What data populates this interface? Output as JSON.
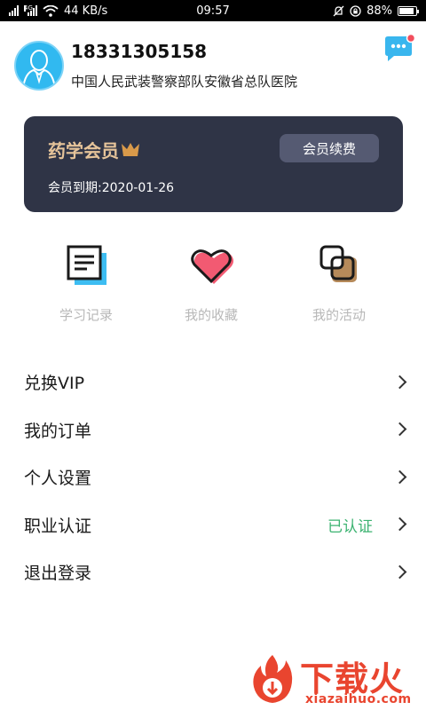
{
  "status_bar": {
    "network_speed": "44 KB/s",
    "time": "09:57",
    "battery": "88%",
    "battery_level": 0.88,
    "sig_tag": "4G"
  },
  "profile": {
    "phone": "18331305158",
    "organization": "中国人民武装警察部队安徽省总队医院"
  },
  "member_card": {
    "title": "药学会员",
    "renew_label": "会员续费",
    "expiry_text": "会员到期:2020-01-26"
  },
  "quick_actions": [
    {
      "label": "学习记录",
      "icon": "study-record-icon"
    },
    {
      "label": "我的收藏",
      "icon": "heart-icon"
    },
    {
      "label": "我的活动",
      "icon": "activity-icon"
    }
  ],
  "menu": [
    {
      "label": "兑换VIP",
      "status": ""
    },
    {
      "label": "我的订单",
      "status": ""
    },
    {
      "label": "个人设置",
      "status": ""
    },
    {
      "label": "职业认证",
      "status": "已认证"
    },
    {
      "label": "退出登录",
      "status": ""
    }
  ],
  "watermark": {
    "title": "下载火",
    "domain": "xiazaihuo.com"
  },
  "colors": {
    "accent_blue": "#31b9f0",
    "card_bg": "#2f3446",
    "gold": "#e6c49a",
    "verified_green": "#3cb371",
    "watermark_red": "#e9452f"
  }
}
